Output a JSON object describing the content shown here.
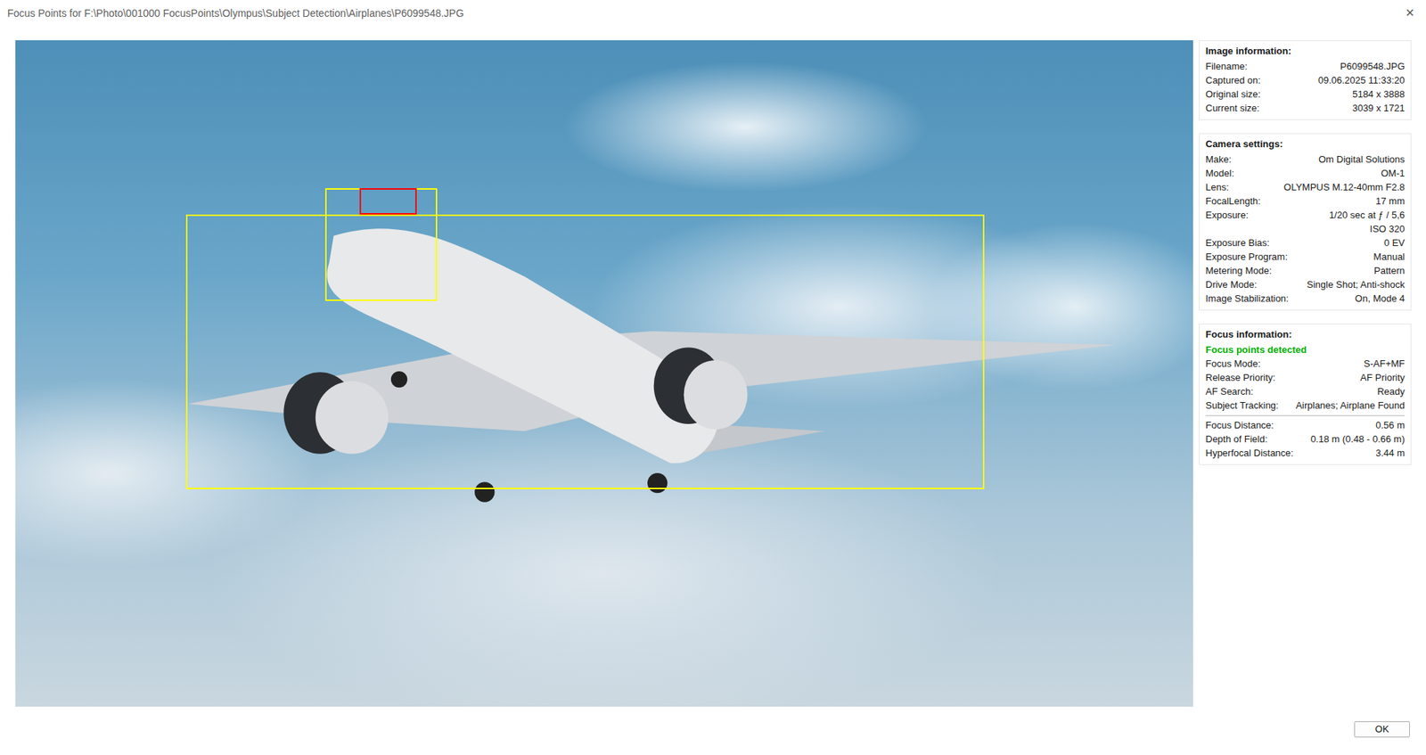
{
  "window": {
    "title": "Focus Points for F:\\Photo\\001000 FocusPoints\\Olympus\\Subject Detection\\Airplanes\\P6099548.JPG",
    "close": "×"
  },
  "focus_frames": [
    {
      "kind": "subject",
      "color": "#ffff00"
    },
    {
      "kind": "subject",
      "color": "#ffff00"
    },
    {
      "kind": "focus",
      "color": "#ff0000"
    }
  ],
  "panels": [
    {
      "title": "Image information:",
      "items": [
        {
          "kind": "row",
          "label": "Filename:",
          "value": "P6099548.JPG"
        },
        {
          "kind": "row",
          "label": "Captured on:",
          "value": "09.06.2025 11:33:20"
        },
        {
          "kind": "row",
          "label": "Original size:",
          "value": "5184 x 3888"
        },
        {
          "kind": "row",
          "label": "Current size:",
          "value": "3039 x 1721"
        }
      ]
    },
    {
      "title": "Camera settings:",
      "items": [
        {
          "kind": "row",
          "label": "Make:",
          "value": "Om Digital Solutions"
        },
        {
          "kind": "row",
          "label": "Model:",
          "value": "OM-1"
        },
        {
          "kind": "row",
          "label": "Lens:",
          "value": "OLYMPUS M.12-40mm F2.8"
        },
        {
          "kind": "row",
          "label": "FocalLength:",
          "value": "17 mm"
        },
        {
          "kind": "row",
          "label": "Exposure:",
          "value": "1/20 sec at ƒ / 5,6"
        },
        {
          "kind": "line",
          "value": "ISO 320"
        },
        {
          "kind": "row",
          "label": "Exposure Bias:",
          "value": "0 EV"
        },
        {
          "kind": "row",
          "label": "Exposure Program:",
          "value": "Manual"
        },
        {
          "kind": "row",
          "label": "Metering Mode:",
          "value": "Pattern"
        },
        {
          "kind": "row",
          "label": "Drive Mode:",
          "value": "Single Shot; Anti-shock"
        },
        {
          "kind": "row",
          "label": "Image Stabilization:",
          "value": "On, Mode 4"
        }
      ]
    },
    {
      "title": "Focus information:",
      "items": [
        {
          "kind": "status",
          "value": "Focus points detected",
          "color": "#00b000"
        },
        {
          "kind": "row",
          "label": "Focus Mode:",
          "value": "S-AF+MF"
        },
        {
          "kind": "row",
          "label": "Release Priority:",
          "value": "AF Priority"
        },
        {
          "kind": "row",
          "label": "AF Search:",
          "value": "Ready"
        },
        {
          "kind": "row",
          "label": "Subject Tracking:",
          "value": "Airplanes; Airplane Found"
        },
        {
          "kind": "divider"
        },
        {
          "kind": "row",
          "label": "Focus Distance:",
          "value": "0.56 m"
        },
        {
          "kind": "row",
          "label": "Depth of Field:",
          "value": "0.18 m (0.48 - 0.66 m)"
        },
        {
          "kind": "row",
          "label": "Hyperfocal Distance:",
          "value": "3.44 m"
        }
      ]
    }
  ],
  "buttons": [
    "OK"
  ]
}
